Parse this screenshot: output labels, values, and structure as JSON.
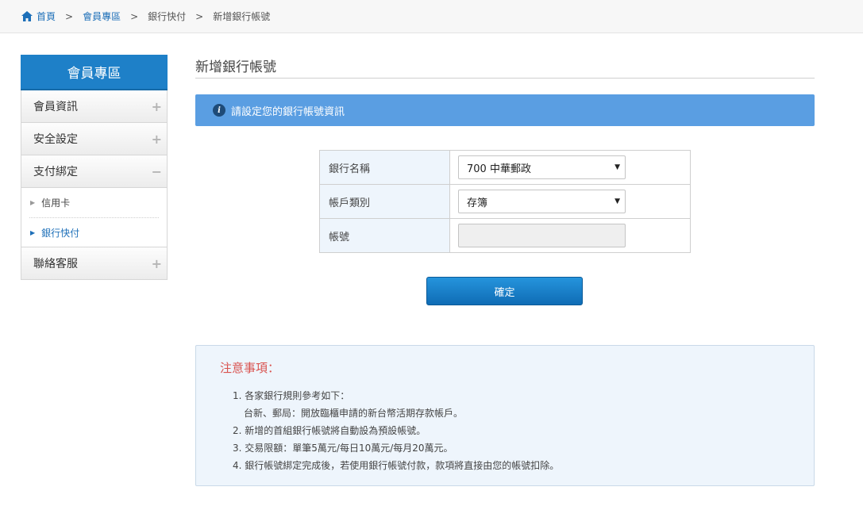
{
  "breadcrumb": {
    "home": "首頁",
    "member": "會員專區",
    "bank": "銀行快付",
    "current": "新增銀行帳號",
    "separator": ">"
  },
  "sidebar": {
    "title": "會員專區",
    "items": [
      {
        "label": "會員資訊",
        "toggle": "+"
      },
      {
        "label": "安全設定",
        "toggle": "+"
      },
      {
        "label": "支付綁定",
        "toggle": "−"
      },
      {
        "label": "聯絡客服",
        "toggle": "+"
      }
    ],
    "subitems": [
      {
        "label": "信用卡",
        "arrow": "▶"
      },
      {
        "label": "銀行快付",
        "arrow": "▶"
      }
    ]
  },
  "main": {
    "title": "新增銀行帳號",
    "banner": "請設定您的銀行帳號資訊",
    "form": {
      "bank_label": "銀行名稱",
      "bank_value": "700 中華郵政",
      "type_label": "帳戶類別",
      "type_value": "存簿",
      "account_label": "帳號",
      "account_value": "",
      "caret": "▼"
    },
    "confirm": "確定",
    "notes": {
      "title": "注意事項：",
      "items": [
        "1. 各家銀行規則參考如下：",
        "台新、郵局：開放臨櫃申請的新台幣活期存款帳戶。",
        "2. 新增的首組銀行帳號將自動設為預設帳號。",
        "3. 交易限額：單筆5萬元/每日10萬元/每月20萬元。",
        "4. 銀行帳號綁定完成後，若使用銀行帳號付款，款項將直接由您的帳號扣除。"
      ]
    }
  },
  "colors": {
    "accent": "#1e80c8",
    "banner": "#5a9ee2",
    "notes_title": "#d9534f"
  },
  "icons": [
    "home-icon",
    "info-icon",
    "plus-icon",
    "minus-icon",
    "caret-down-icon",
    "arrow-right-icon"
  ]
}
